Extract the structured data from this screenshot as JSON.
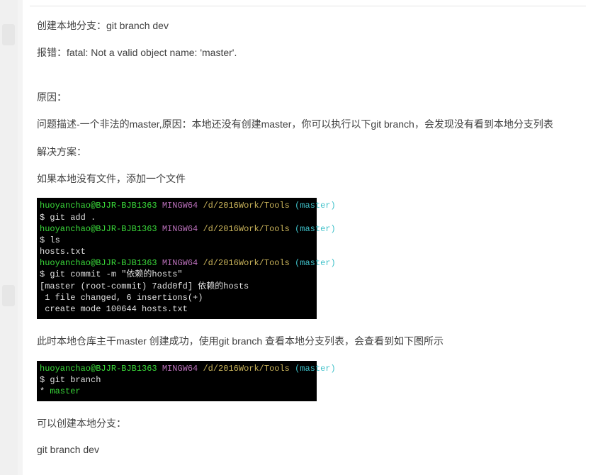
{
  "article": {
    "line1": "创建本地分支：git branch dev",
    "line2": "报错：fatal: Not a valid object name: 'master'.",
    "reason_label": "原因：",
    "reason_desc": " 问题描述-一个非法的master,原因：本地还没有创建master，你可以执行以下git branch，会发现没有看到本地分支列表",
    "solution_label": "解决方案：",
    "solution_step1": "  如果本地没有文件，添加一个文件",
    "after_commit": "此时本地仓库主干master 创建成功，使用git branch 查看本地分支列表，会查看到如下图所示",
    "can_create": "可以创建本地分支：",
    "cmd_branch": " git branch dev"
  },
  "term1": {
    "prompt_user": "huoyanchao@BJJR-BJB1363",
    "mingw": " MINGW64 ",
    "path": "/d/2016Work/Tools",
    "branch": " (master)",
    "cmd_add": "$ git add .",
    "cmd_ls": "$ ls",
    "ls_out": "hosts.txt",
    "cmd_commit": "$ git commit -m \"依赖的hosts\"",
    "commit_out1": "[master (root-commit) 7add0fd] 依赖的hosts",
    "commit_out2": " 1 file changed, 6 insertions(+)",
    "commit_out3": " create mode 100644 hosts.txt"
  },
  "term2": {
    "prompt_user": "huoyanchao@BJJR-BJB1363",
    "mingw": " MINGW64 ",
    "path": "/d/2016Work/Tools",
    "branch": " (master)",
    "cmd_branch": "$ git branch",
    "out_marker": "* ",
    "out_master": "master"
  }
}
